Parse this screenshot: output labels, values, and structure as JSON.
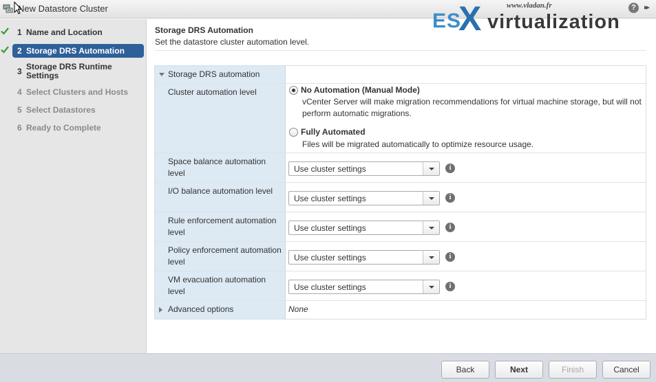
{
  "window": {
    "title": "New Datastore Cluster",
    "help_glyph": "?",
    "expand_glyph": "▸▸"
  },
  "watermark": {
    "url": "www.vladan.fr",
    "es": "ES",
    "x": "X",
    "rest": "virtualization"
  },
  "steps": [
    {
      "num": "1",
      "label": "Name and Location",
      "state": "done"
    },
    {
      "num": "2",
      "label": "Storage DRS Automation",
      "state": "active"
    },
    {
      "num": "3",
      "label": "Storage DRS Runtime Settings",
      "state": "upcoming"
    },
    {
      "num": "4",
      "label": "Select Clusters and Hosts",
      "state": "disabled"
    },
    {
      "num": "5",
      "label": "Select Datastores",
      "state": "disabled"
    },
    {
      "num": "6",
      "label": "Ready to Complete",
      "state": "disabled"
    }
  ],
  "main": {
    "title": "Storage DRS Automation",
    "subtitle": "Set the datastore cluster automation level."
  },
  "table": {
    "section_label": "Storage DRS automation",
    "cluster_level_label": "Cluster automation level",
    "options": [
      {
        "title": "No Automation (Manual Mode)",
        "desc": "vCenter Server will make migration recommendations for virtual machine storage, but will not perform automatic migrations.",
        "selected": true
      },
      {
        "title": "Fully Automated",
        "desc": "Files will be migrated automatically to optimize resource usage.",
        "selected": false
      }
    ],
    "levels": [
      {
        "label": "Space balance automation level",
        "value": "Use cluster settings"
      },
      {
        "label": "I/O balance automation level",
        "value": "Use cluster settings"
      },
      {
        "label": "Rule enforcement automation level",
        "value": "Use cluster settings"
      },
      {
        "label": "Policy enforcement automation level",
        "value": "Use cluster settings"
      },
      {
        "label": "VM evacuation automation level",
        "value": "Use cluster settings"
      }
    ],
    "info_glyph": "i",
    "advanced_label": "Advanced options",
    "advanced_value": "None"
  },
  "footer": {
    "back": "Back",
    "next": "Next",
    "finish": "Finish",
    "cancel": "Cancel"
  },
  "colors": {
    "active_step": "#2e6099",
    "check": "#3a9a3a",
    "label_column": "#dde9f3"
  }
}
